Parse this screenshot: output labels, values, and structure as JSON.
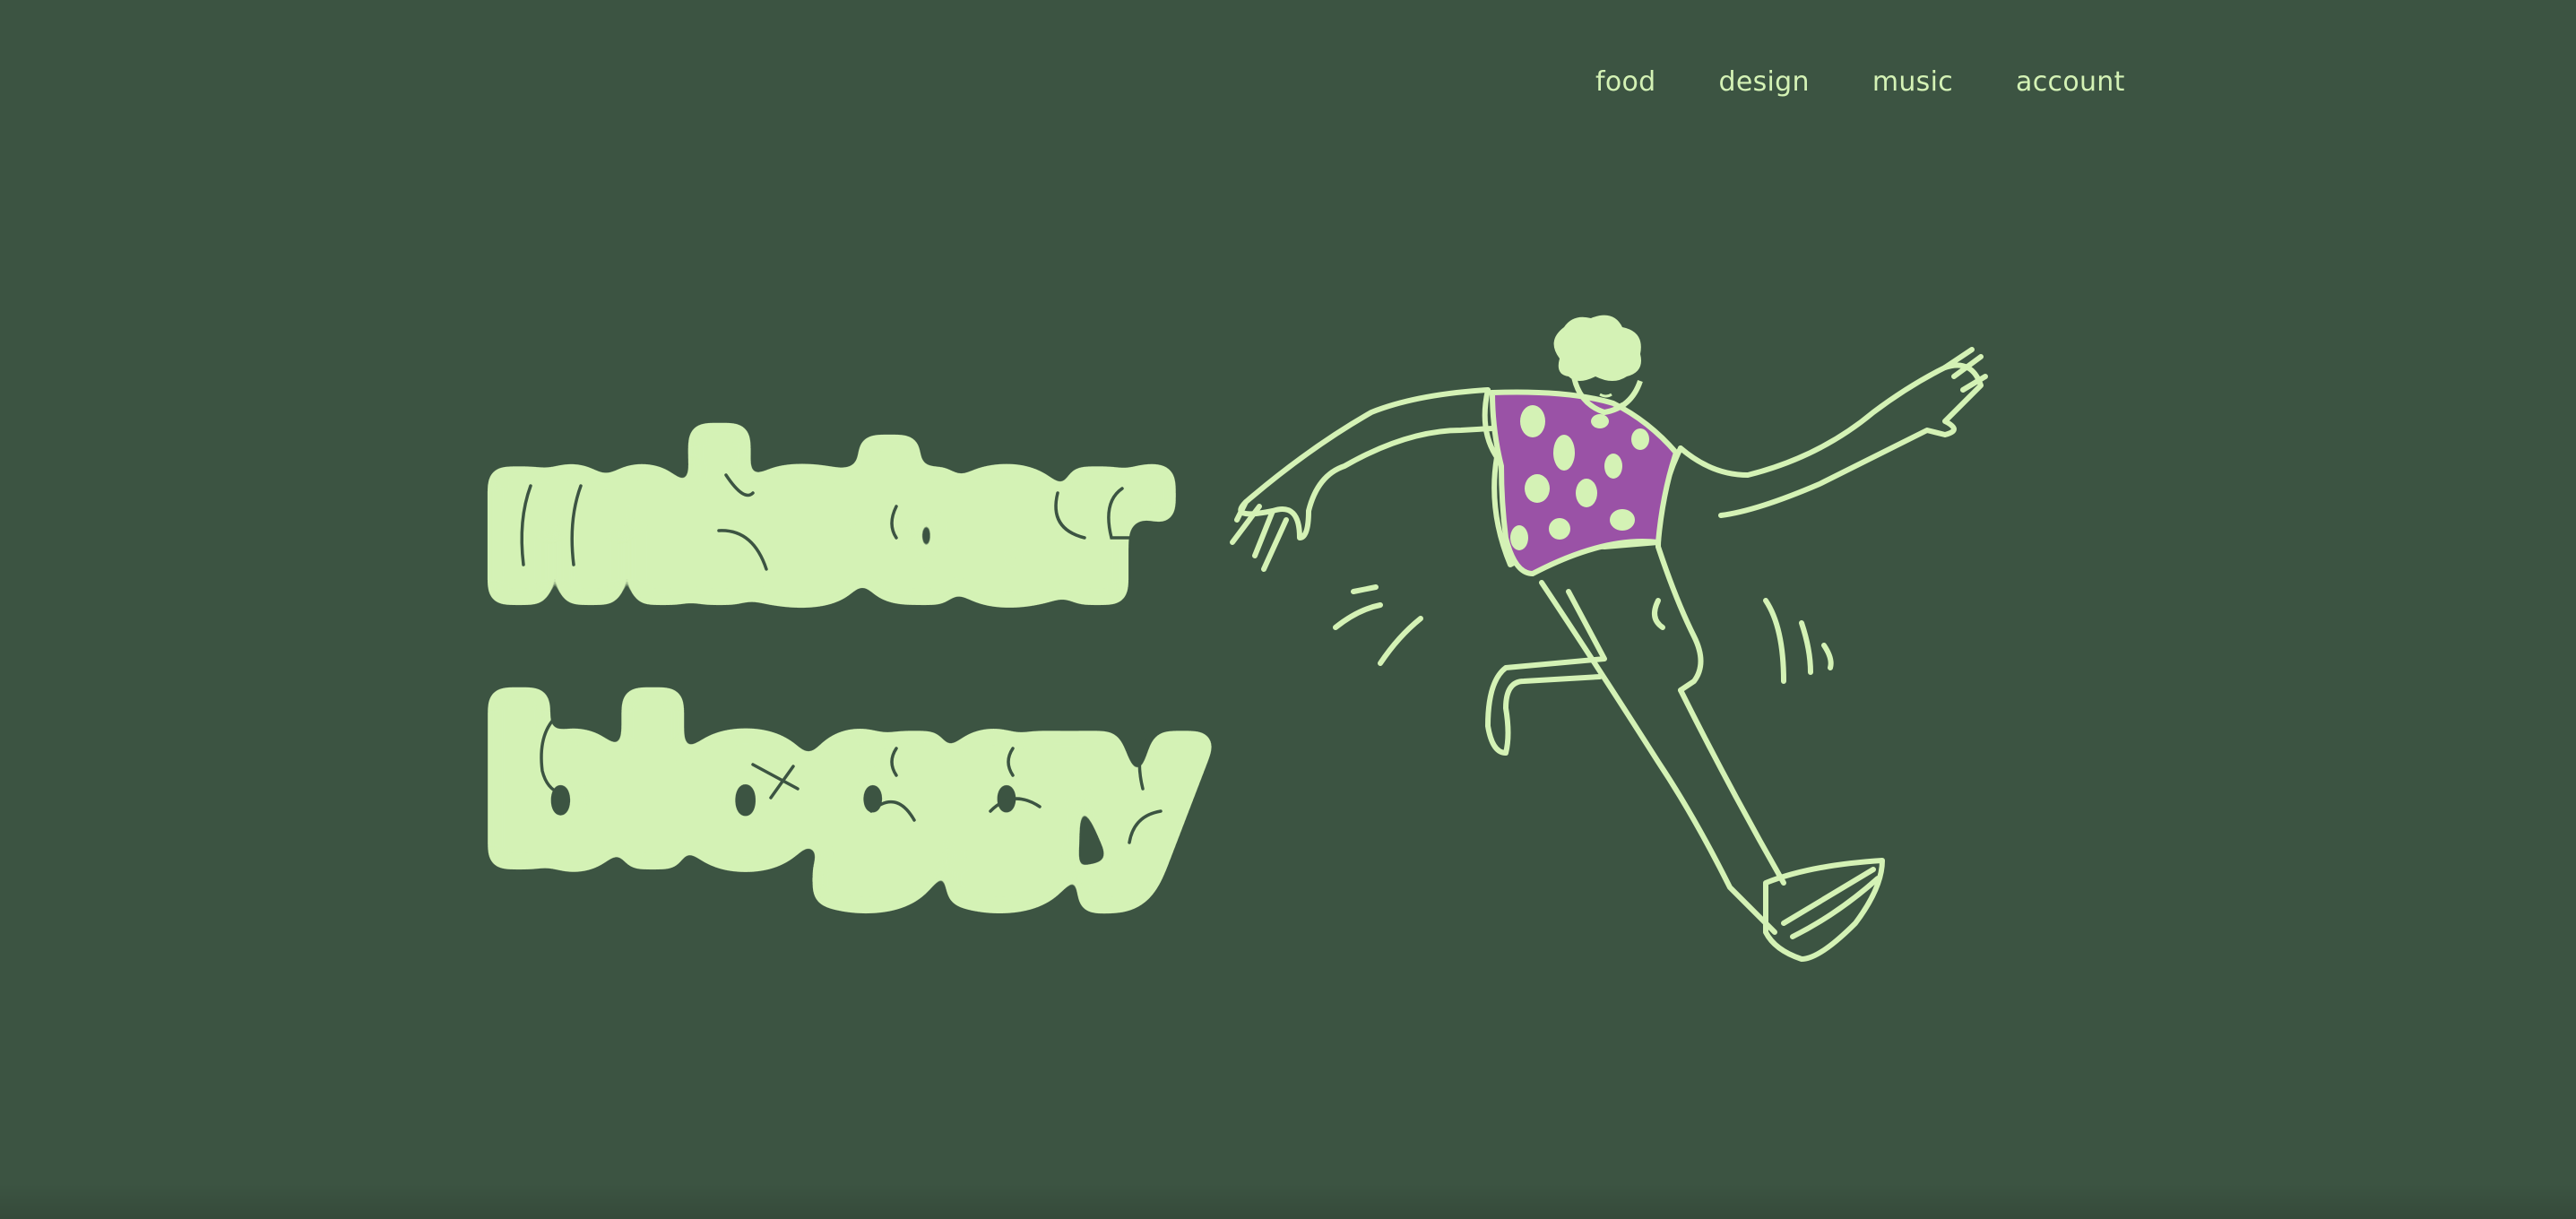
{
  "nav": {
    "items": [
      {
        "label": "food"
      },
      {
        "label": "design"
      },
      {
        "label": "music"
      },
      {
        "label": "account"
      }
    ]
  },
  "hero": {
    "title_line1": "mister",
    "title_line2": "bloggy"
  },
  "colors": {
    "background": "#3c5442",
    "accent": "#d4f2b5",
    "shirt": "#9a52a6",
    "line": "#3c5442"
  },
  "icons": {
    "illustration": "dancing-man-illustration"
  }
}
